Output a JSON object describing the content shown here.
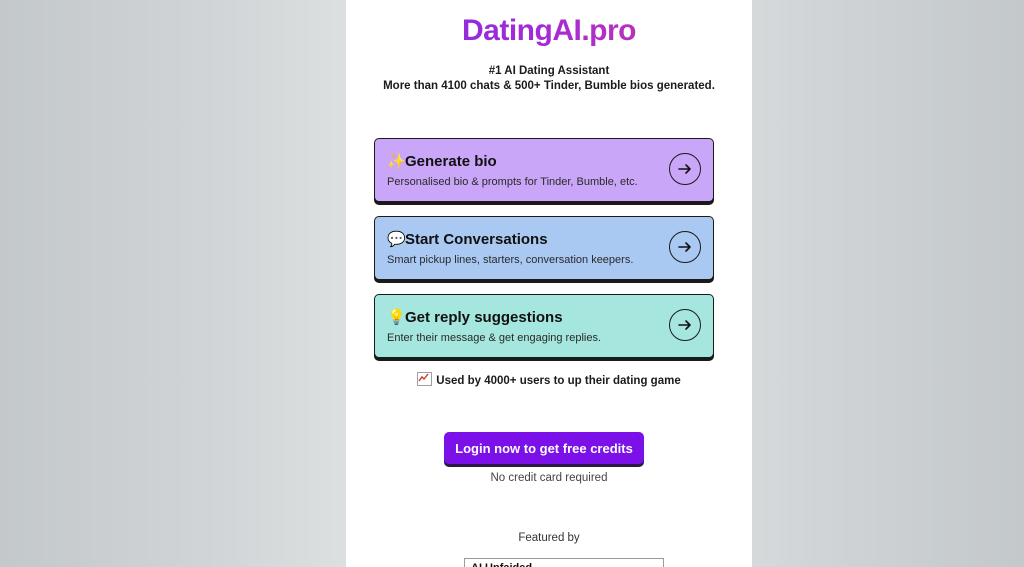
{
  "brand": {
    "name": "DatingAI.pro"
  },
  "tagline": {
    "line1": "#1 AI Dating Assistant",
    "line2": "More than 4100 chats & 500+ Tinder, Bumble bios generated."
  },
  "cards": [
    {
      "emoji": "✨",
      "title": "Generate bio",
      "desc": "Personalised bio & prompts for Tinder, Bumble, etc.",
      "color": "#c9a6f7",
      "icon": "arrow-right-icon"
    },
    {
      "emoji": "💬",
      "title": "Start Conversations",
      "desc": "Smart pickup lines, starters, conversation keepers.",
      "color": "#a9c8f2",
      "icon": "arrow-right-icon"
    },
    {
      "emoji": "💡",
      "title": "Get reply suggestions",
      "desc": "Enter their message & get engaging replies.",
      "color": "#a5e6de",
      "icon": "arrow-right-icon"
    }
  ],
  "social_proof": {
    "text": "Used by 4000+ users to up their dating game",
    "icon": "chart-icon"
  },
  "cta": {
    "label": "Login now to get free credits",
    "color": "#7b10e8"
  },
  "cta_note": "No credit card required",
  "featured": {
    "label": "Featured by",
    "badge_text": "AI Unfaided"
  }
}
